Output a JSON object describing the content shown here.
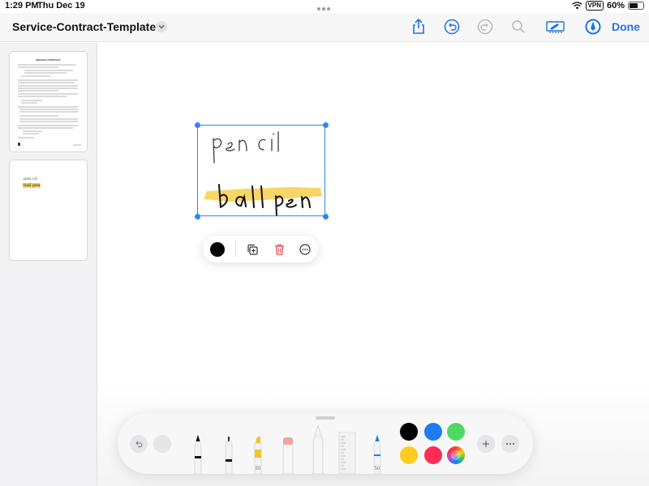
{
  "status_bar": {
    "time": "1:29 PM",
    "date": "Thu Dec 19",
    "vpn": "VPN",
    "battery": "60%",
    "battery_level": 0.6
  },
  "nav_bar": {
    "title": "Service-Contract-Template 2",
    "done_label": "Done",
    "icons": [
      "share-icon",
      "undo-icon",
      "redo-icon",
      "search-icon",
      "markup-pen-icon",
      "pencil-markup-icon"
    ]
  },
  "sidebar": {
    "pages": [
      {
        "heading": "SERVICE CONTRACT"
      },
      {
        "note": "pen cil",
        "note2": "ball pen"
      }
    ]
  },
  "canvas": {
    "ink_text": [
      "pencil",
      "ball pen"
    ],
    "highlight_color": "#f7d154",
    "selection_color": "#2f86f0"
  },
  "context_menu": {
    "items": [
      "color-swatch",
      "duplicate-icon",
      "delete-icon",
      "more-icon"
    ],
    "current_color": "#000000",
    "delete_color": "#e5484d"
  },
  "palette": {
    "tool_labels": {
      "highlighter": "50",
      "blue_pen": "50"
    },
    "colors": [
      "#000000",
      "#1e7cf0",
      "#4cd964",
      "#ffcc1e",
      "#ff2d55",
      "color-wheel"
    ]
  }
}
